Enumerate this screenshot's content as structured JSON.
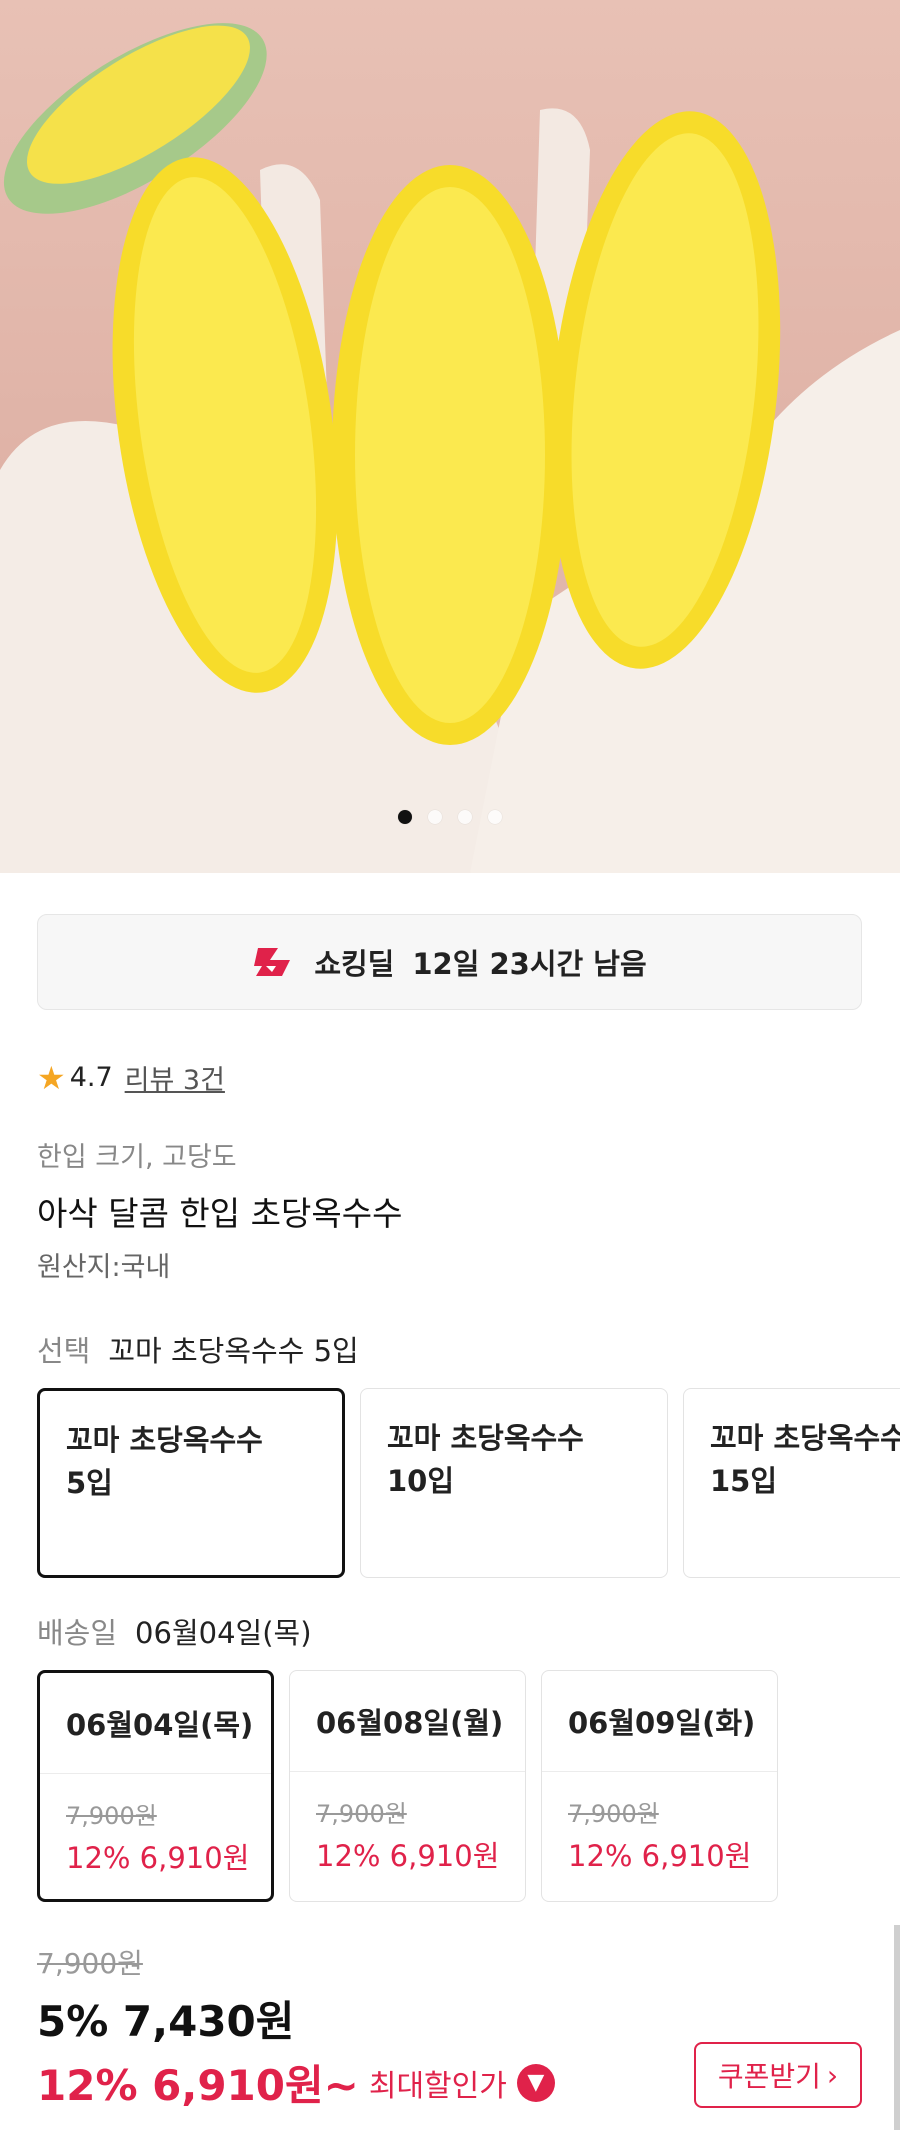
{
  "hero": {
    "image_desc": "",
    "slide_count": 4,
    "active_slide": 1
  },
  "deal": {
    "icon": "shocking-deal-icon",
    "label": "쇼킹딜",
    "time_left": "12일 23시간 남음"
  },
  "rating": {
    "score": "4.7",
    "review_link": "리뷰 3건"
  },
  "product": {
    "tagline": "한입 크기, 고당도",
    "title": "아삭 달콤 한입 초당옥수수",
    "origin": "원산지:국내"
  },
  "option_section": {
    "label": "선택",
    "selected": "꼬마 초당옥수수 5입"
  },
  "options": [
    {
      "line1": "꼬마 초당옥수수",
      "line2": "5입"
    },
    {
      "line1": "꼬마 초당옥수수",
      "line2": "10입"
    },
    {
      "line1": "꼬마 초당옥수수",
      "line2": "15입"
    }
  ],
  "delivery_section": {
    "label": "배송일",
    "selected": "06월04일(목)"
  },
  "deliveries": [
    {
      "date": "06월04일(목)",
      "orig_price": "7,900원",
      "sale": "12% 6,910원"
    },
    {
      "date": "06월08일(월)",
      "orig_price": "7,900원",
      "sale": "12% 6,910원"
    },
    {
      "date": "06월09일(화)",
      "orig_price": "7,900원",
      "sale": "12% 6,910원"
    }
  ],
  "price": {
    "original": "7,900원",
    "current": "5% 7,430원",
    "max_discount": "12% 6,910원~",
    "max_label": "최대할인가",
    "coupon_button": "쿠폰받기"
  },
  "colors": {
    "accent": "#e0224a",
    "star": "#f5a623"
  }
}
